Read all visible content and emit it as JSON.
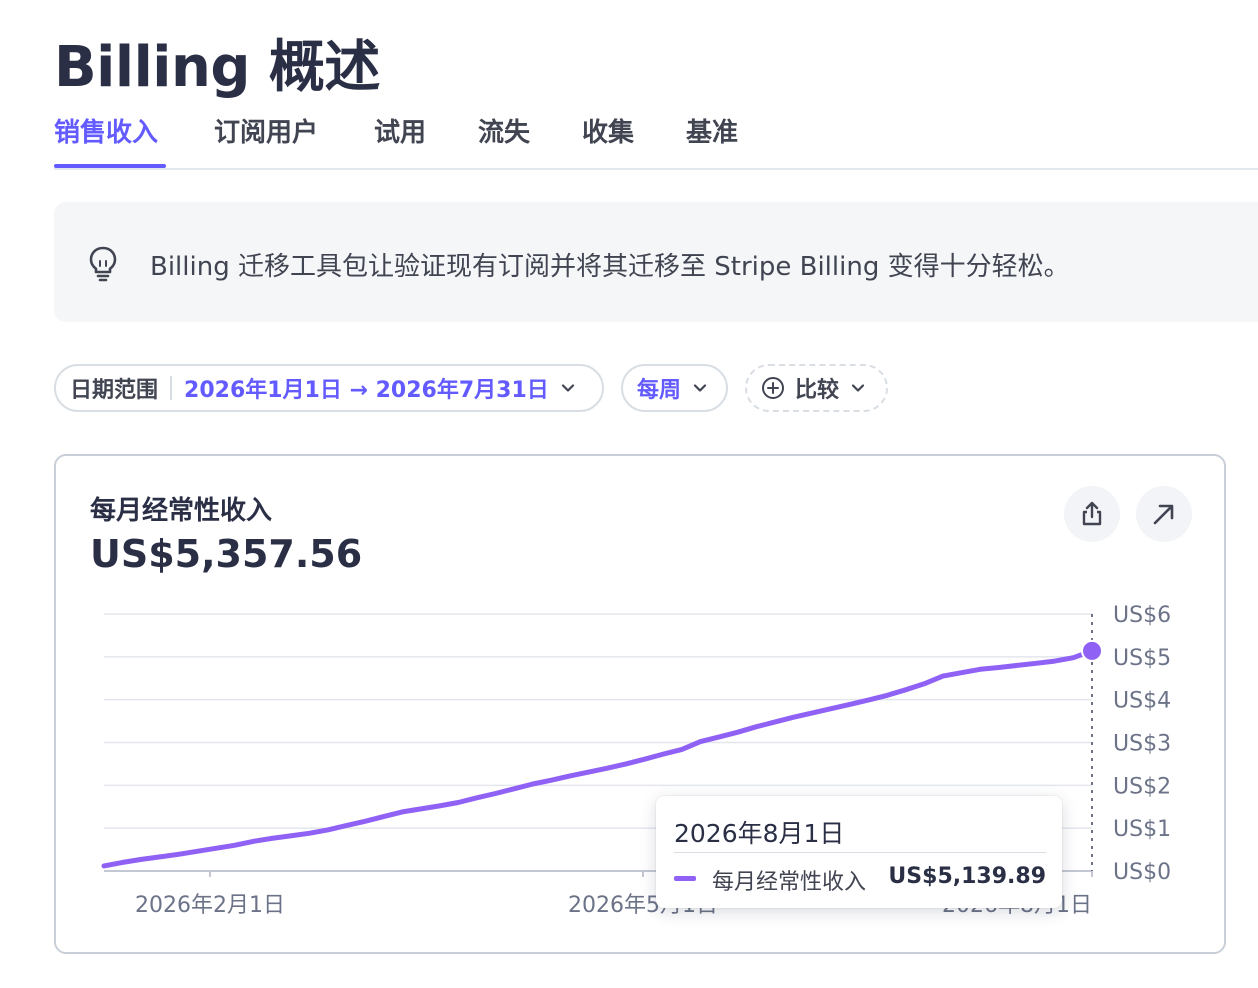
{
  "page": {
    "title": "Billing 概述"
  },
  "tabs": [
    {
      "label": "销售收入",
      "active": true
    },
    {
      "label": "订阅用户",
      "active": false
    },
    {
      "label": "试用",
      "active": false
    },
    {
      "label": "流失",
      "active": false
    },
    {
      "label": "收集",
      "active": false
    },
    {
      "label": "基准",
      "active": false
    }
  ],
  "banner": {
    "icon": "lightbulb-icon",
    "text": "Billing 迁移工具包让验证现有订阅并将其迁移至 Stripe Billing 变得十分轻松。"
  },
  "filters": {
    "date_range_label": "日期范围",
    "date_range_value": "2026年1月1日 → 2026年7月31日",
    "interval_value": "每周",
    "compare_label": "比较"
  },
  "card": {
    "title": "每月经常性收入",
    "value": "US$5,357.56",
    "export_icon": "share-export-icon",
    "expand_icon": "arrow-up-right-icon"
  },
  "tooltip": {
    "date": "2026年8月1日",
    "series_name": "每月经常性收入",
    "series_value": "US$5,139.89"
  },
  "colors": {
    "accent": "#635bff",
    "series": "#8f62f5"
  },
  "chart_data": {
    "type": "line",
    "series": [
      {
        "name": "每月经常性收入",
        "x": [
          0,
          4,
          8,
          12,
          16,
          20,
          24,
          28,
          32,
          36,
          40,
          44,
          48,
          52,
          56,
          60,
          64,
          68,
          72,
          76,
          80,
          84,
          88,
          92,
          96,
          100,
          104,
          108,
          112,
          116,
          120,
          124,
          128,
          132,
          136,
          140,
          144,
          148,
          152,
          156,
          160,
          164,
          168,
          172,
          176,
          180,
          184,
          188,
          192,
          196,
          200,
          204,
          208,
          212
        ],
        "values": [
          0.12,
          0.2,
          0.27,
          0.33,
          0.39,
          0.46,
          0.53,
          0.6,
          0.69,
          0.76,
          0.82,
          0.88,
          0.96,
          1.06,
          1.16,
          1.27,
          1.38,
          1.45,
          1.52,
          1.6,
          1.71,
          1.81,
          1.92,
          2.03,
          2.12,
          2.22,
          2.31,
          2.4,
          2.5,
          2.61,
          2.73,
          2.84,
          3.02,
          3.13,
          3.24,
          3.37,
          3.48,
          3.59,
          3.69,
          3.79,
          3.89,
          3.99,
          4.1,
          4.23,
          4.37,
          4.55,
          4.63,
          4.71,
          4.75,
          4.8,
          4.85,
          4.9,
          4.98,
          5.14
        ]
      }
    ],
    "x_tick_labels": [
      "2026年2月1日",
      "2026年5月1日",
      "2026年8月1日"
    ],
    "y_tick_labels": [
      "US$0",
      "US$1",
      "US$2",
      "US$3",
      "US$4",
      "US$5",
      "US$6"
    ],
    "ylim": [
      0,
      6
    ],
    "grid": true,
    "y_axis_side": "right"
  }
}
